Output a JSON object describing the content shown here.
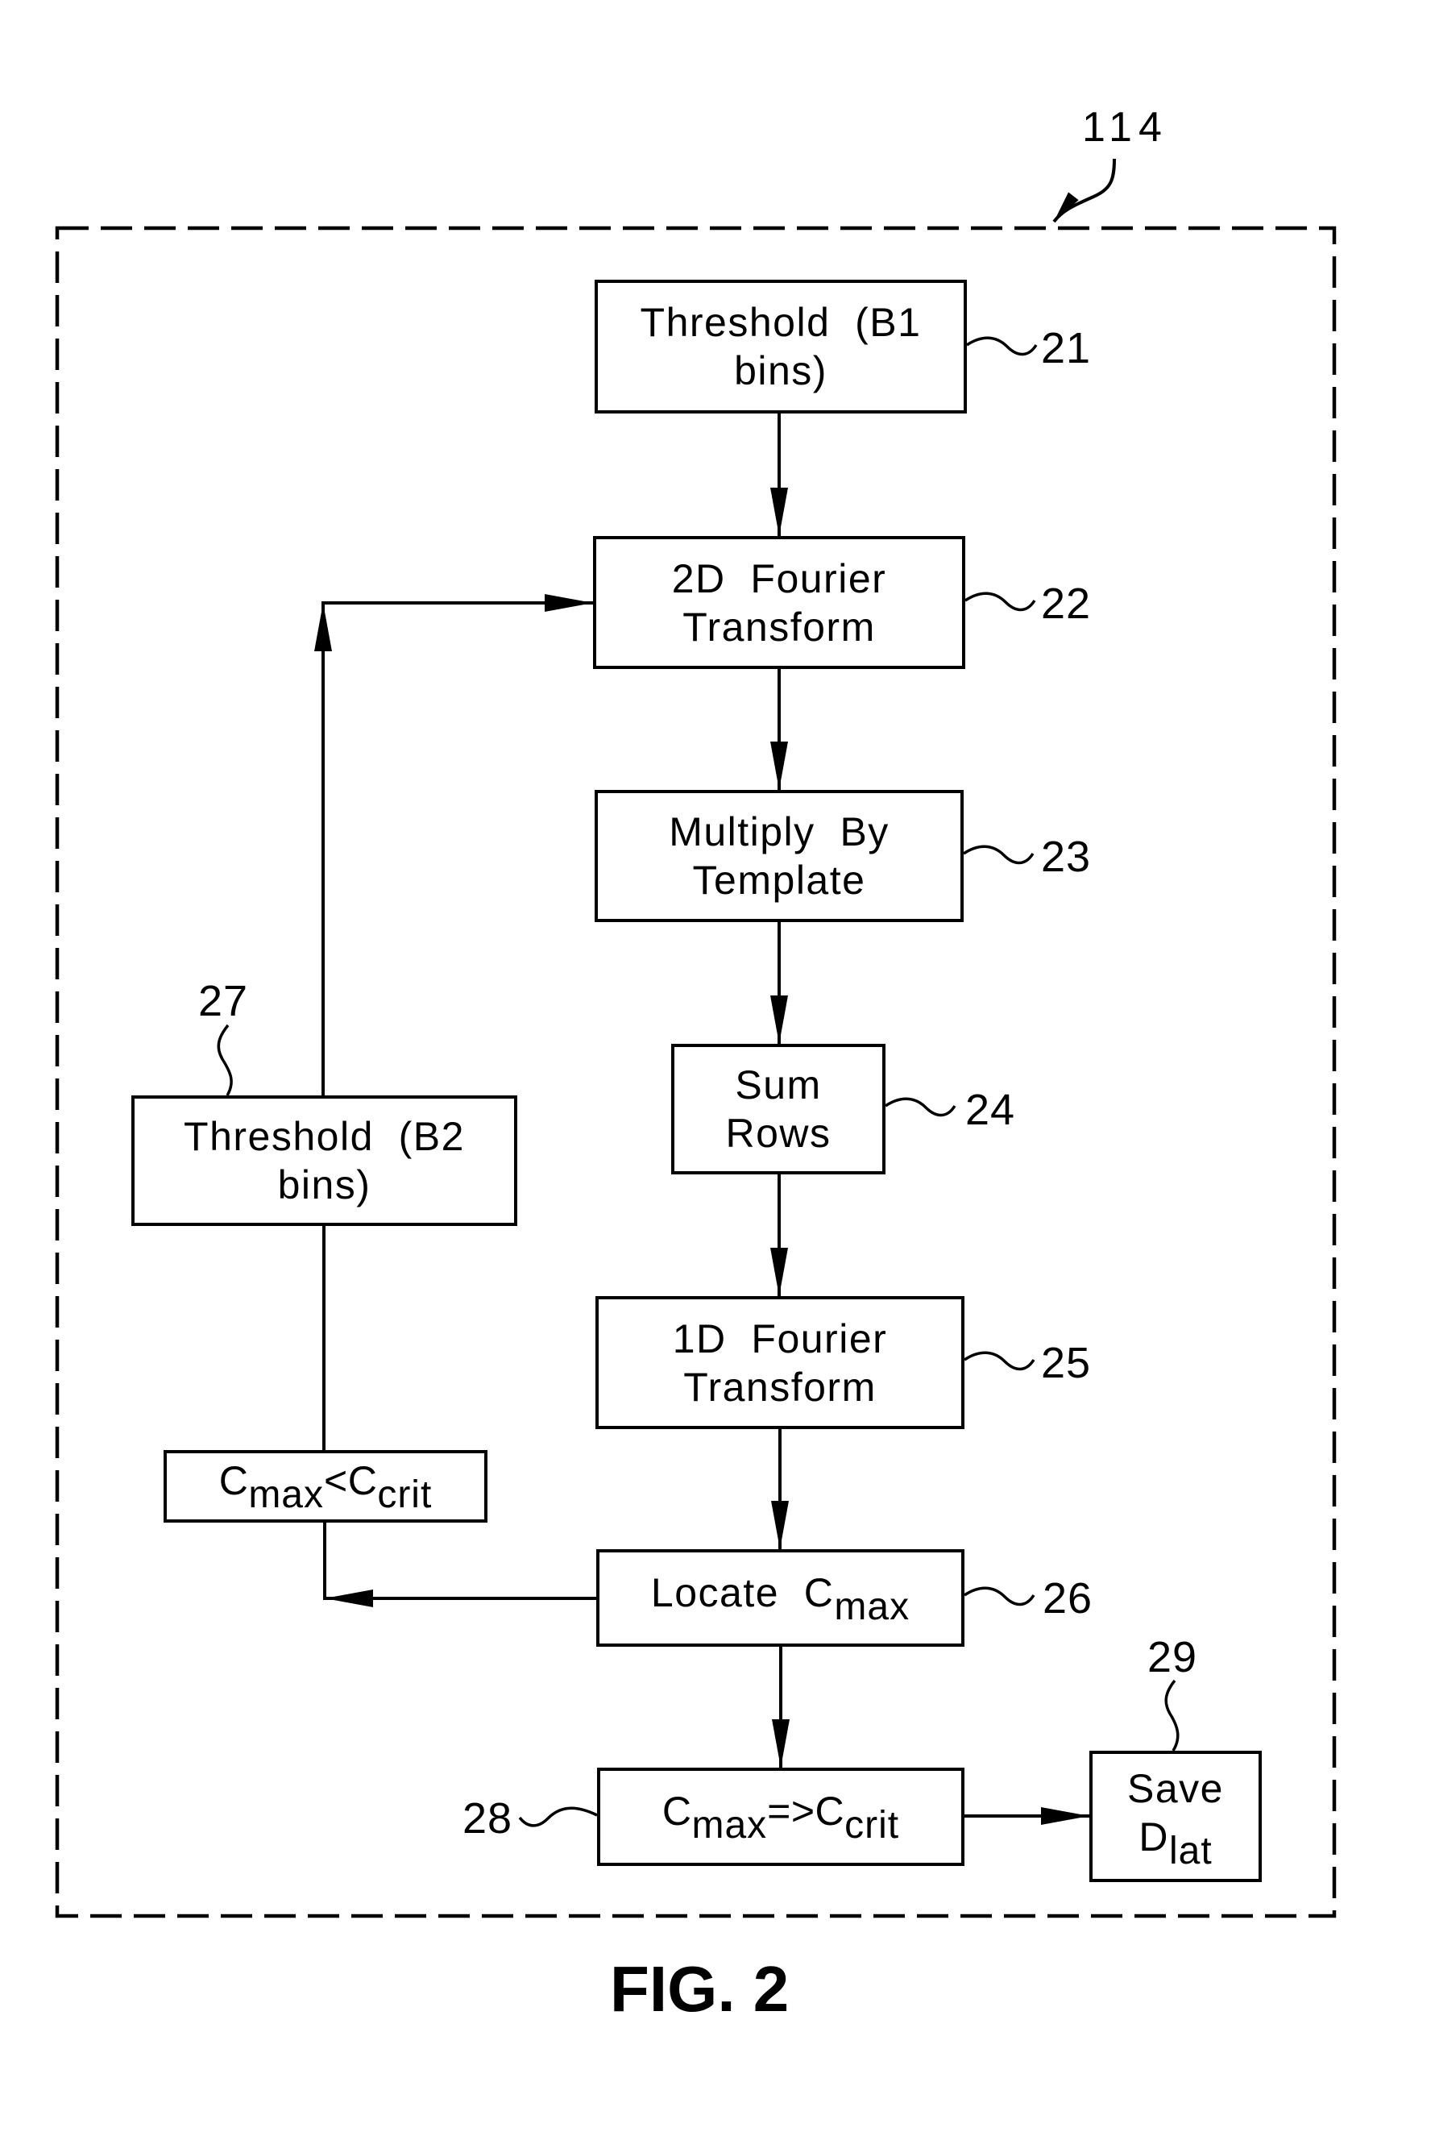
{
  "figure": {
    "caption": "FIG. 2",
    "module_ref": "114"
  },
  "colors": {
    "ink": "#000000",
    "paper": "#ffffff"
  },
  "steps": {
    "s21": {
      "ref": "21",
      "lines": [
        "Threshold  (B1",
        "bins)"
      ]
    },
    "s22": {
      "ref": "22",
      "lines": [
        "2D  Fourier",
        "Transform"
      ]
    },
    "s23": {
      "ref": "23",
      "lines": [
        "Multiply  By",
        "Template"
      ]
    },
    "s24": {
      "ref": "24",
      "lines": [
        "Sum",
        "Rows"
      ]
    },
    "s25": {
      "ref": "25",
      "lines": [
        "1D  Fourier",
        "Transform"
      ]
    },
    "s26": {
      "ref": "26",
      "text": "Locate  C",
      "sub": "max"
    },
    "s27": {
      "ref": "27",
      "lines": [
        "Threshold  (B2",
        "bins)"
      ]
    },
    "cond_fail": {
      "c1": "C",
      "sub1": "max",
      "op": "<",
      "c2": "C",
      "sub2": "crit"
    },
    "s28": {
      "ref": "28",
      "c1": "C",
      "sub1": "max",
      "op": "=>",
      "c2": "C",
      "sub2": "crit"
    },
    "s29": {
      "ref": "29",
      "line1": "Save",
      "c": "D",
      "sub": "lat"
    }
  }
}
